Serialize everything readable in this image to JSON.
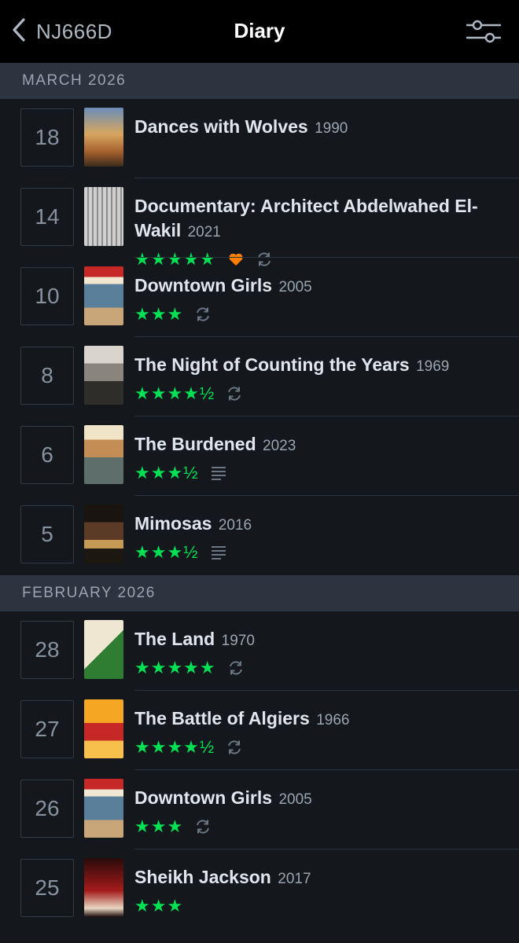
{
  "nav": {
    "back_label": "NJ666D",
    "title": "Diary"
  },
  "colors": {
    "stars": "#00e054",
    "heart": "#ff8000",
    "header_bg": "#2c3440"
  },
  "sections": [
    {
      "label": "MARCH 2026",
      "entries": [
        {
          "day": "18",
          "title": "Dances with Wolves",
          "year": "1990",
          "rating": "",
          "liked": false,
          "rewatch": false,
          "review": false
        },
        {
          "day": "14",
          "title": "Documentary: Architect Abdelwahed El-Wakil",
          "year": "2021",
          "rating": "★★★★★",
          "liked": true,
          "rewatch": true,
          "review": false
        },
        {
          "day": "10",
          "title": "Downtown Girls",
          "year": "2005",
          "rating": "★★★",
          "liked": false,
          "rewatch": true,
          "review": false
        },
        {
          "day": "8",
          "title": "The Night of Counting the Years",
          "year": "1969",
          "rating": "★★★★½",
          "liked": false,
          "rewatch": true,
          "review": false
        },
        {
          "day": "6",
          "title": "The Burdened",
          "year": "2023",
          "rating": "★★★½",
          "liked": false,
          "rewatch": false,
          "review": true
        },
        {
          "day": "5",
          "title": "Mimosas",
          "year": "2016",
          "rating": "★★★½",
          "liked": false,
          "rewatch": false,
          "review": true
        }
      ]
    },
    {
      "label": "FEBRUARY 2026",
      "entries": [
        {
          "day": "28",
          "title": "The Land",
          "year": "1970",
          "rating": "★★★★★",
          "liked": false,
          "rewatch": true,
          "review": false
        },
        {
          "day": "27",
          "title": "The Battle of Algiers",
          "year": "1966",
          "rating": "★★★★½",
          "liked": false,
          "rewatch": true,
          "review": false
        },
        {
          "day": "26",
          "title": "Downtown Girls",
          "year": "2005",
          "rating": "★★★",
          "liked": false,
          "rewatch": true,
          "review": false
        },
        {
          "day": "25",
          "title": "Sheikh Jackson",
          "year": "2017",
          "rating": "★★★",
          "liked": false,
          "rewatch": false,
          "review": false
        }
      ]
    }
  ]
}
